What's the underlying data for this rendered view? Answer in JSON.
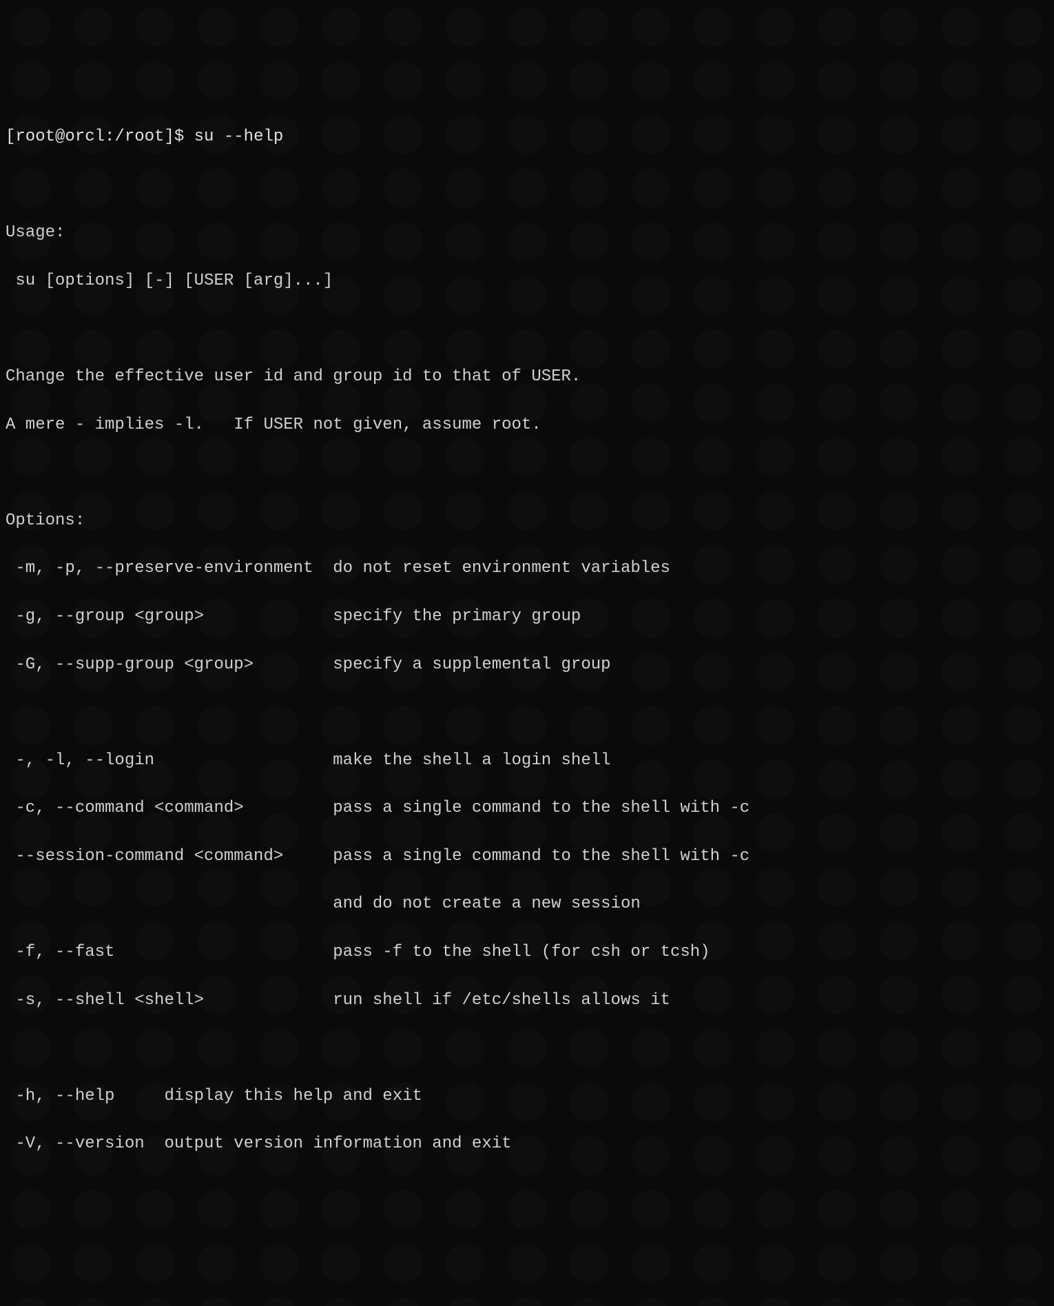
{
  "prompt": "[root@orcl:/root]$ ",
  "command": "su --help",
  "lines": {
    "usage_header": "Usage:",
    "usage_line": " su [options] [-] [USER [arg]...]",
    "desc1": "Change the effective user id and group id to that of USER.",
    "desc2": "A mere - implies -l.   If USER not given, assume root.",
    "options_header": "Options:",
    "opt_m": " -m, -p, --preserve-environment  do not reset environment variables",
    "opt_g": " -g, --group <group>             specify the primary group",
    "opt_G": " -G, --supp-group <group>        specify a supplemental group",
    "opt_l": " -, -l, --login                  make the shell a login shell",
    "opt_c": " -c, --command <command>         pass a single command to the shell with -c",
    "opt_session": " --session-command <command>     pass a single command to the shell with -c",
    "opt_session2": "                                 and do not create a new session",
    "opt_f": " -f, --fast                      pass -f to the shell (for csh or tcsh)",
    "opt_s": " -s, --shell <shell>             run shell if /etc/shells allows it",
    "opt_h": " -h, --help     display this help and exit",
    "opt_V": " -V, --version  output version information and exit"
  }
}
